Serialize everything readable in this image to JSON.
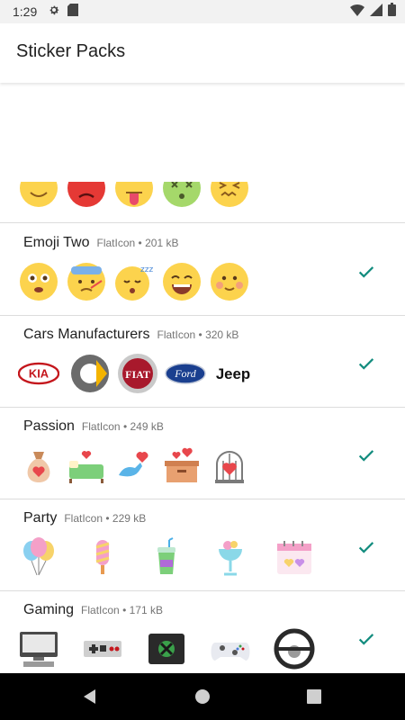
{
  "status_bar": {
    "time": "1:29",
    "icons": [
      "gear-icon",
      "sd-card-icon",
      "wifi-icon",
      "signal-icon",
      "battery-icon"
    ]
  },
  "app_bar": {
    "title": "Sticker Packs"
  },
  "colors": {
    "accent": "#128c7e",
    "divider": "#dcdcdc",
    "emoji_yellow": "#fcd34d",
    "nav_bar": "#000000"
  },
  "packs": [
    {
      "name": "Emoji Two",
      "publisher": "FlatIcon",
      "separator": "•",
      "size": "201 kB",
      "added": true,
      "stickers": [
        "surprised-face-sticker",
        "sick-face-sticker",
        "sleeping-face-sticker",
        "grinning-face-sticker",
        "blushing-face-sticker"
      ]
    },
    {
      "name": "Cars Manufacturers",
      "publisher": "FlatIcon",
      "separator": "•",
      "size": "320 kB",
      "added": true,
      "stickers": [
        "kia-logo-sticker",
        "smart-logo-sticker",
        "fiat-logo-sticker",
        "ford-logo-sticker",
        "jeep-logo-sticker"
      ],
      "logo_text": {
        "kia": "KIA",
        "fiat": "FIAT",
        "ford": "Ford",
        "jeep": "Jeep"
      }
    },
    {
      "name": "Passion",
      "publisher": "FlatIcon",
      "separator": "•",
      "size": "249 kB",
      "added": true,
      "stickers": [
        "heart-sack-sticker",
        "heart-bed-sticker",
        "bird-heart-sticker",
        "heart-box-sticker",
        "heart-cage-sticker"
      ]
    },
    {
      "name": "Party",
      "publisher": "FlatIcon",
      "separator": "•",
      "size": "229 kB",
      "added": true,
      "stickers": [
        "balloons-sticker",
        "popsicle-sticker",
        "drink-cup-sticker",
        "cocktail-glass-sticker",
        "calendar-hearts-sticker"
      ]
    },
    {
      "name": "Gaming",
      "publisher": "FlatIcon",
      "separator": "•",
      "size": "171 kB",
      "added": true,
      "stickers": [
        "computer-sticker",
        "nes-controller-sticker",
        "xbox-console-sticker",
        "xbox-controller-sticker",
        "steering-wheel-sticker"
      ]
    }
  ],
  "nav_bar": {
    "buttons": [
      "back-icon",
      "home-icon",
      "recents-icon"
    ]
  }
}
